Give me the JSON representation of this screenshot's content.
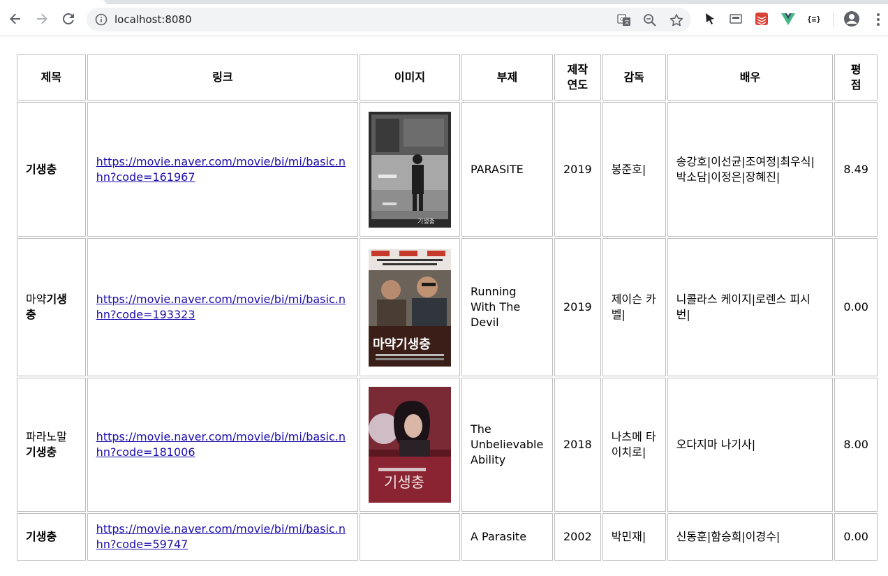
{
  "browser": {
    "url": "localhost:8080"
  },
  "table": {
    "headers": [
      "제목",
      "링크",
      "이미지",
      "부제",
      "제작연도",
      "감독",
      "배우",
      "평점"
    ],
    "headers_split": {
      "year": [
        "제작",
        "연도"
      ],
      "score": [
        "평",
        "점"
      ]
    },
    "rows": [
      {
        "title_pre": "",
        "title_bold": "기생충",
        "link": "https://movie.naver.com/movie/bi/mi/basic.nhn?code=161967",
        "image": "poster-parasite",
        "subtitle": "PARASITE",
        "year": "2019",
        "director": "봉준호|",
        "actors": "송강호|이선균|조여정|최우식|박소담|이정은|장혜진|",
        "score": "8.49"
      },
      {
        "title_pre": "마약",
        "title_bold": "기생충",
        "link": "https://movie.naver.com/movie/bi/mi/basic.nhn?code=193323",
        "image": "poster-running-with-the-devil",
        "subtitle": "Running With The Devil",
        "year": "2019",
        "director": "제이슨 카벨|",
        "actors": "니콜라스 케이지|로렌스 피시번|",
        "score": "0.00"
      },
      {
        "title_pre": "파라노말 ",
        "title_bold": "기생충",
        "link": "https://movie.naver.com/movie/bi/mi/basic.nhn?code=181006",
        "image": "poster-unbelievable-ability",
        "subtitle": "The Unbelievable Ability",
        "year": "2018",
        "director": "나츠메 타이치로|",
        "actors": "오다지마 나기사|",
        "score": "8.00"
      },
      {
        "title_pre": "",
        "title_bold": "기생충",
        "link": "https://movie.naver.com/movie/bi/mi/basic.nhn?code=59747",
        "image": "",
        "subtitle": "A Parasite",
        "year": "2002",
        "director": "박민재|",
        "actors": "신동훈|함승희|이경수|",
        "score": "0.00"
      }
    ]
  },
  "poster_texts": {
    "parasite": "기생충",
    "devil": "마약기생충",
    "ability": "기생충"
  },
  "colors": {
    "link": "#1a0dab",
    "border": "#bdbdbd"
  }
}
